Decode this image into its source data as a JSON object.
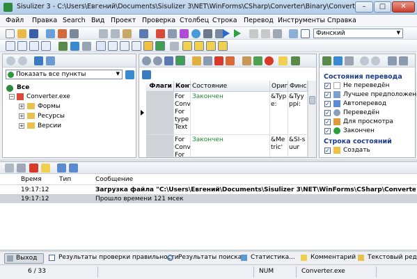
{
  "window": {
    "title": "Sisulizer 3 - C:\\Users\\Евгений\\Documents\\Sisulizer 3\\NET\\WinForms\\CSharp\\Converter\\Binary\\Converter.slp",
    "minimize": "–",
    "maximize": "□",
    "close": "✕"
  },
  "menu": [
    "Файл",
    "Правка",
    "Search",
    "Вид",
    "Проект",
    "Проверка",
    "Столбец",
    "Строка",
    "Перевод",
    "Инструменты",
    "Справка"
  ],
  "language_select": {
    "value": "Финский",
    "arrow": "▼"
  },
  "left_panel": {
    "filter_value": "Показать все пункты",
    "filter_arrow": "▼",
    "tree": {
      "root": "Все",
      "project": "Converter.exe",
      "children": [
        "Формы",
        "Ресурсы",
        "Версии"
      ],
      "expander": "+",
      "collapser": "−"
    }
  },
  "grid": {
    "columns": [
      "Флаги",
      "Конт",
      "Состояние",
      "Ориг",
      "Финс"
    ],
    "rows": [
      {
        "context": "For\nConv\nFor\ntype\nText",
        "status": "Закончен",
        "original": "&Type:",
        "finnish": "&Tyyppi:"
      },
      {
        "context": "For\nConv\nFor",
        "status": "Закончен",
        "original": "&Metric'",
        "finnish": "&SI-suur"
      }
    ]
  },
  "right_panel": {
    "section1_title": "Состояния перевода",
    "states": [
      "Не переведён",
      "Лучшее предположение",
      "Автоперевод",
      "Переведён",
      "Для просмотра",
      "Закончен"
    ],
    "section2_title": "Строка состояний",
    "row_states": [
      "Создать"
    ]
  },
  "log": {
    "headers": [
      "Время",
      "Тип",
      "Сообщение"
    ],
    "rows": [
      {
        "time": "19:17:12",
        "type": "",
        "message": "Загрузка файла \"C:\\Users\\Евгений\\Documents\\Sisulizer 3\\NET\\WinForms\\CSharp\\Converter\\Binary\\Conve"
      },
      {
        "time": "19:17:12",
        "type": "",
        "message": "Прошло времени 121 мсек"
      }
    ]
  },
  "bottom_tabs": [
    "Выход",
    "Результаты проверки правильности",
    "Результаты поиска",
    "Статистика...",
    "Комментарий",
    "Текстовый реда"
  ],
  "status": {
    "position": "6 / 33",
    "num": "NUM",
    "file": "Converter.exe"
  },
  "colors": {
    "accent": "#2c6ac4",
    "done": "#1f8a2c",
    "selected": "#cfd3d8"
  }
}
